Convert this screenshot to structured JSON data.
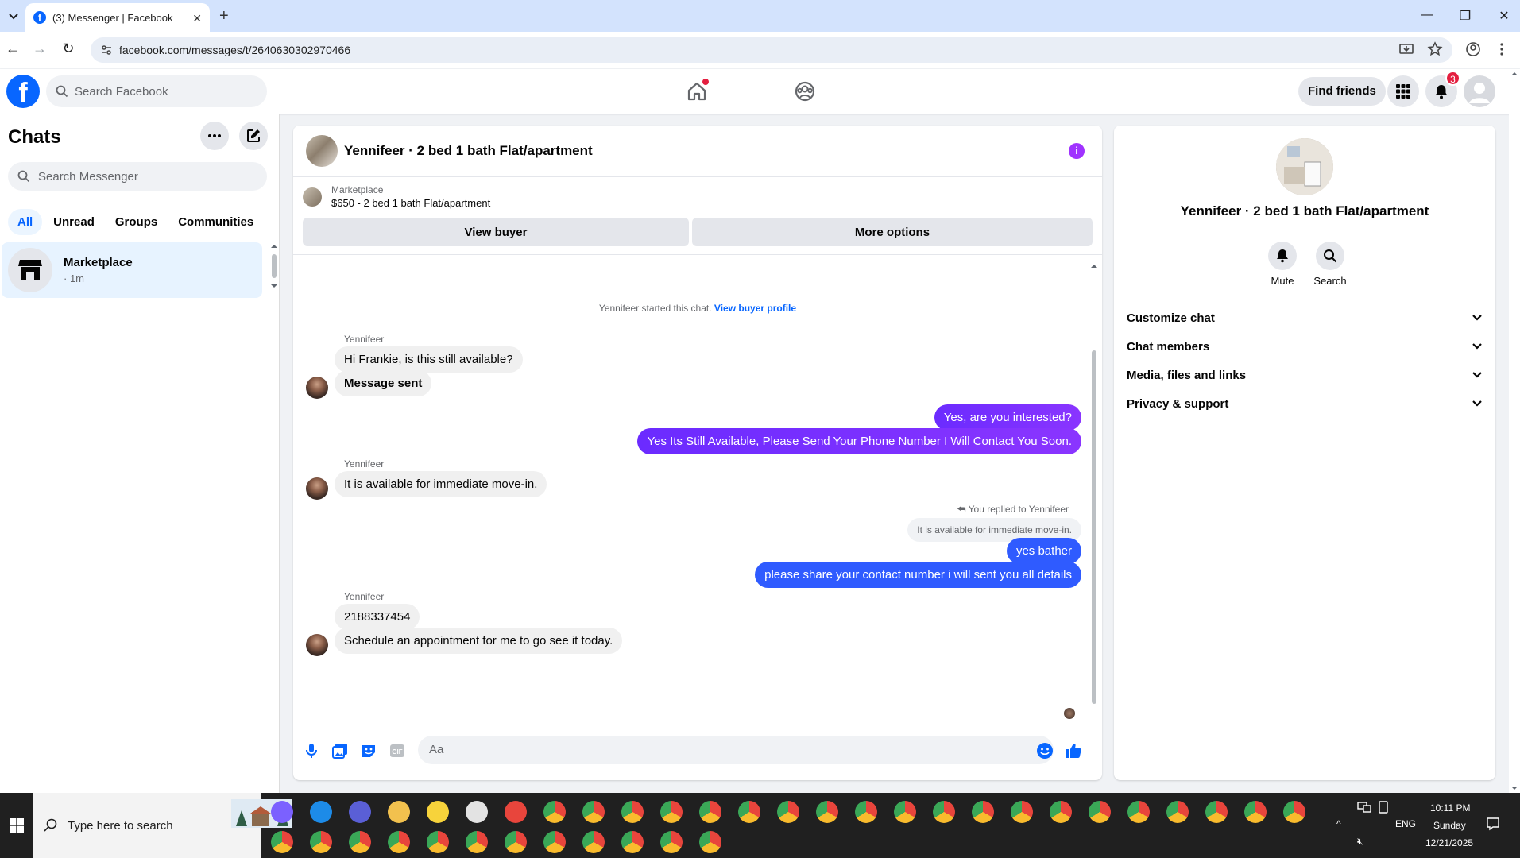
{
  "browser": {
    "tab_title": "(3) Messenger | Facebook",
    "url": "facebook.com/messages/t/2640630302970466",
    "favicon": "facebook-icon"
  },
  "fb_header": {
    "search_placeholder": "Search Facebook",
    "find_friends": "Find friends",
    "notifications_badge": "3"
  },
  "sidebar": {
    "title": "Chats",
    "search_placeholder": "Search Messenger",
    "filters": [
      "All",
      "Unread",
      "Groups",
      "Communities"
    ],
    "active_filter": "All",
    "chats": [
      {
        "name": "Marketplace",
        "time": "· 1m"
      }
    ]
  },
  "conversation": {
    "title": "Yennifeer · 2 bed 1 bath Flat/apartment",
    "marketplace_label": "Marketplace",
    "listing": "$650 - 2 bed 1 bath Flat/apartment",
    "view_buyer": "View buyer",
    "more_options": "More options",
    "system_text": "Yennifeer started this chat.",
    "system_link": "View buyer profile",
    "messages": [
      {
        "sender": "Yennifeer",
        "text": "Hi Frankie, is this still available?"
      },
      {
        "text": "Message sent"
      },
      {
        "text": "Yes, are you interested?"
      },
      {
        "text": "Yes Its Still Available, Please Send Your Phone Number I Will Contact You Soon."
      },
      {
        "sender": "Yennifeer",
        "text": "It is available for immediate move-in."
      },
      {
        "reply_header": "You replied to Yennifeer",
        "quoted": "It is available for immediate move-in."
      },
      {
        "text": "yes bather"
      },
      {
        "text": "please share your contact number i will sent you all details"
      },
      {
        "sender": "Yennifeer",
        "text": "2188337454"
      },
      {
        "text": "Schedule an appointment for me to go see it today."
      }
    ],
    "composer_placeholder": "Aa",
    "accent_color": "#a033ff"
  },
  "details": {
    "name": "Yennifeer · 2 bed 1 bath Flat/apartment",
    "actions": [
      "Mute",
      "Search"
    ],
    "sections": [
      "Customize chat",
      "Chat members",
      "Media, files and links",
      "Privacy & support"
    ]
  },
  "taskbar": {
    "search_placeholder": "Type here to search",
    "time": "10:11 PM",
    "day": "Sunday",
    "date": "12/21/2025",
    "lang": "ENG"
  }
}
